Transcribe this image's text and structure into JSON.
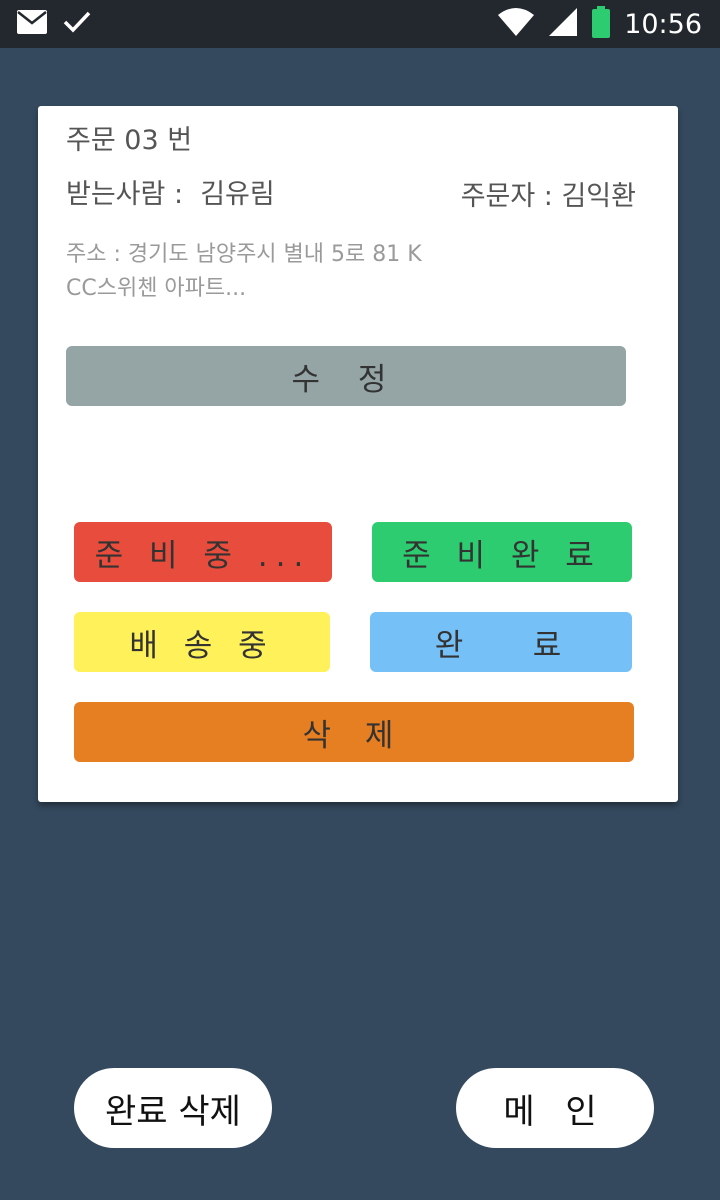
{
  "status_bar": {
    "time": "10:56",
    "icons": [
      "mail-icon",
      "check-icon",
      "wifi-icon",
      "signal-icon",
      "battery-icon"
    ],
    "battery_color": "#2ecc71"
  },
  "order": {
    "title": "주문 03 번",
    "receiver": "받는사람 :  김유림",
    "orderer": "주문자 : 김익환",
    "address": "주소 : 경기도 남양주시 별내 5로 81 K CC스위첸 아파트..."
  },
  "buttons": {
    "edit": "수 정",
    "preparing": "준 비 중 ...",
    "prepared": "준 비 완 료",
    "shipping": "배 송 중",
    "complete": "완    료",
    "delete": "삭 제"
  },
  "bottom": {
    "delete_completed": "완료 삭제",
    "main": "메 인"
  },
  "colors": {
    "background": "#34495e",
    "edit": "#95a5a6",
    "preparing": "#e74c3c",
    "prepared": "#2ecc71",
    "shipping": "#fff15a",
    "complete": "#74c0f7",
    "delete": "#e67e22"
  }
}
